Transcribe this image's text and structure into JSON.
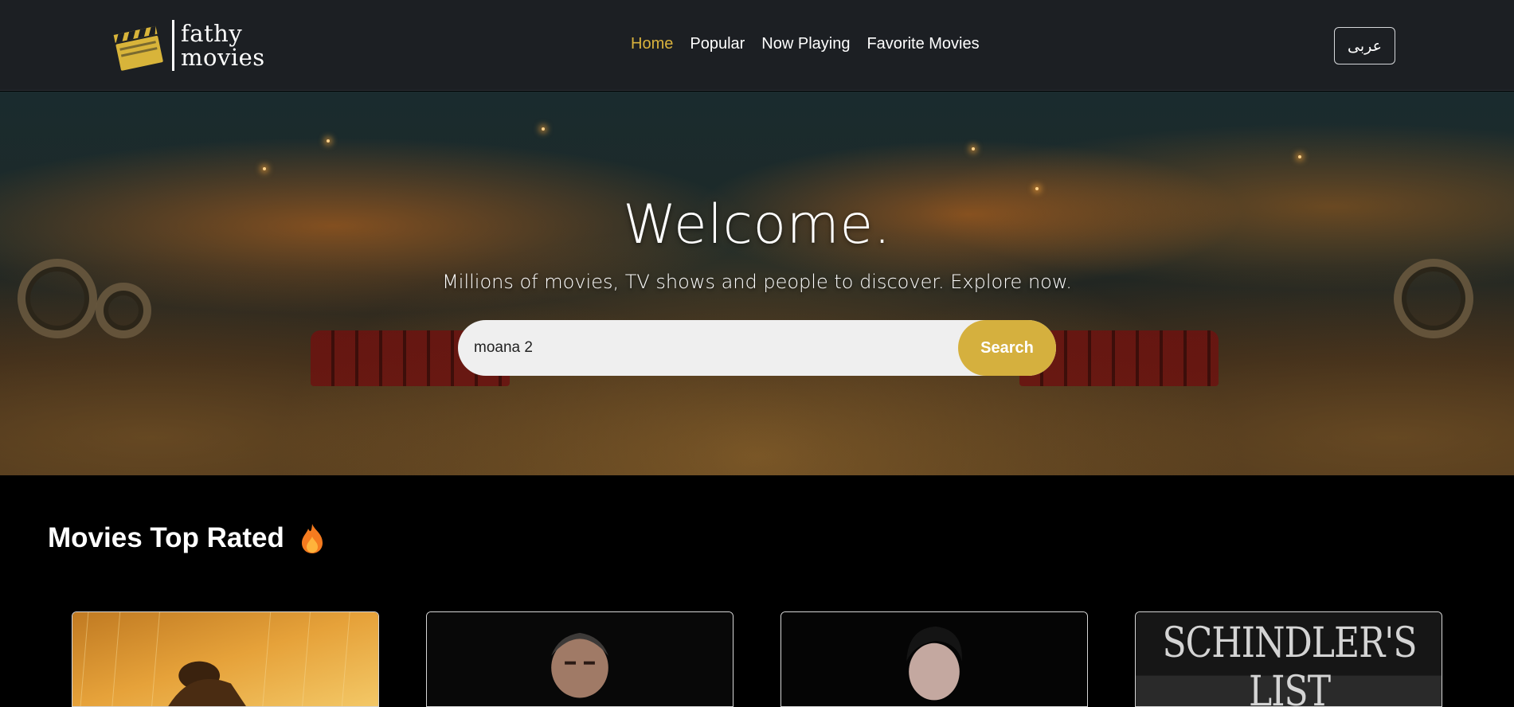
{
  "brand": {
    "line1": "fathy",
    "line2": "movies"
  },
  "nav": {
    "items": [
      {
        "label": "Home",
        "active": true
      },
      {
        "label": "Popular",
        "active": false
      },
      {
        "label": "Now Playing",
        "active": false
      },
      {
        "label": "Favorite Movies",
        "active": false
      }
    ],
    "language_button": "عربى"
  },
  "hero": {
    "title": "Welcome.",
    "subtitle": "Millions of movies, TV shows and people to discover. Explore now.",
    "search": {
      "value": "moana 2",
      "button": "Search"
    }
  },
  "section": {
    "title": "Movies Top Rated"
  },
  "movies": [
    {
      "poster_icon": "rain-figure-poster"
    },
    {
      "poster_icon": "man-in-suit-poster"
    },
    {
      "poster_icon": "young-man-poster"
    },
    {
      "poster_icon": "title-card-poster",
      "poster_text": "SCHINDLER'S LIST"
    }
  ],
  "colors": {
    "navbar_bg": "#1c1f23",
    "accent": "#d5b03e",
    "active_link": "#d9b23d",
    "page_bg": "#000000",
    "search_bg": "#efefef"
  }
}
